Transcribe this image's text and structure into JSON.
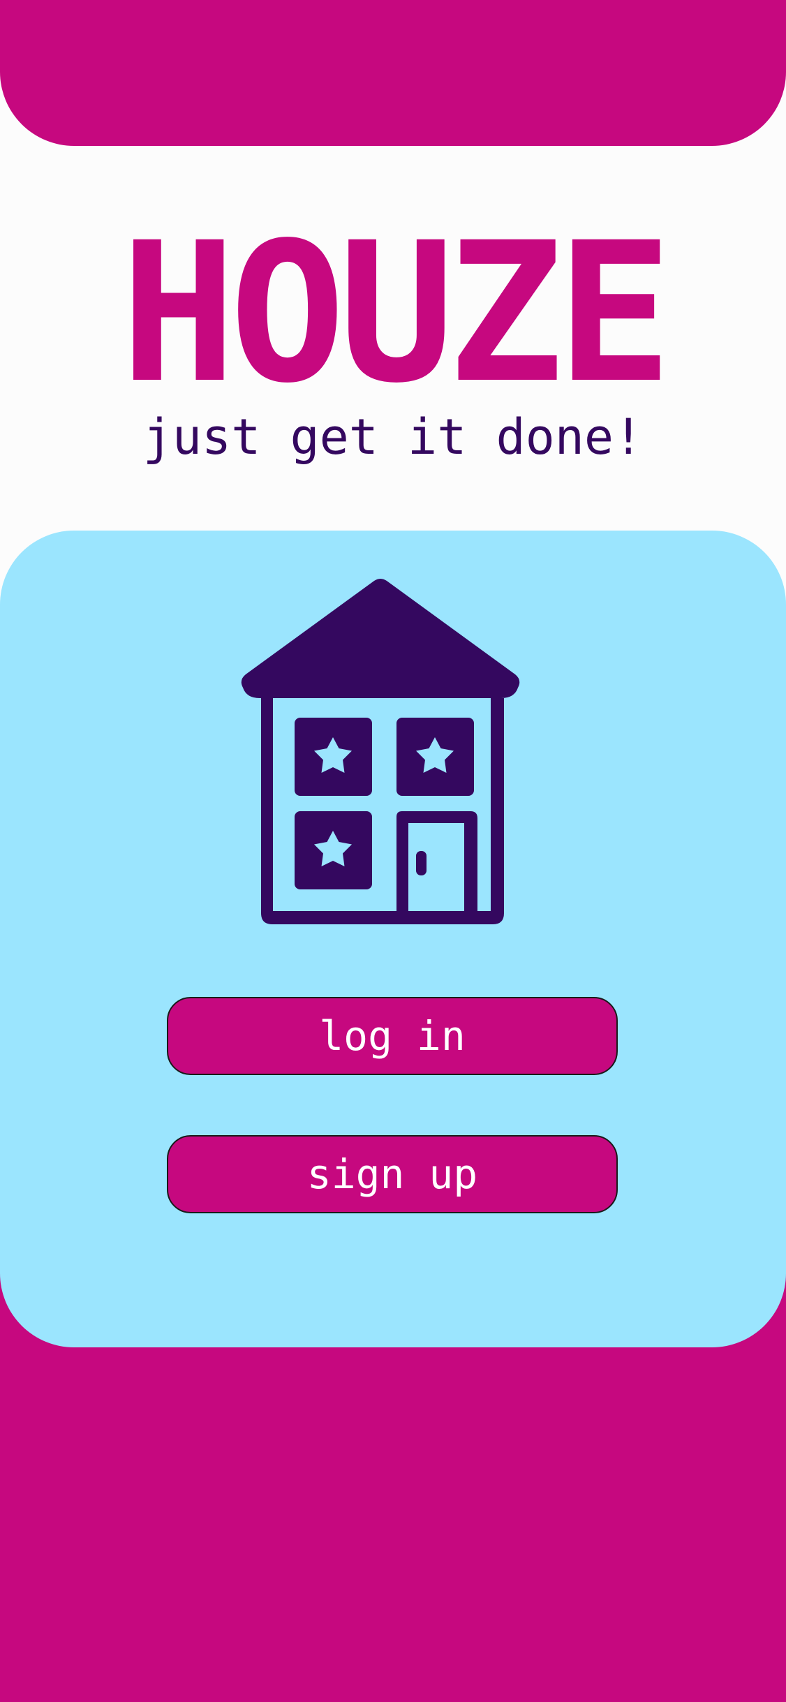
{
  "app": {
    "name": "HOUZE",
    "tagline": "just get it done!"
  },
  "hero": {
    "icon": "house-icon"
  },
  "actions": {
    "login_label": "log in",
    "signup_label": "sign up"
  },
  "colors": {
    "brand_magenta": "#c6087f",
    "accent_light_blue": "#9be5fe",
    "dark_purple": "#34085f",
    "background": "#fcfcfc",
    "button_text": "#ffffff"
  }
}
